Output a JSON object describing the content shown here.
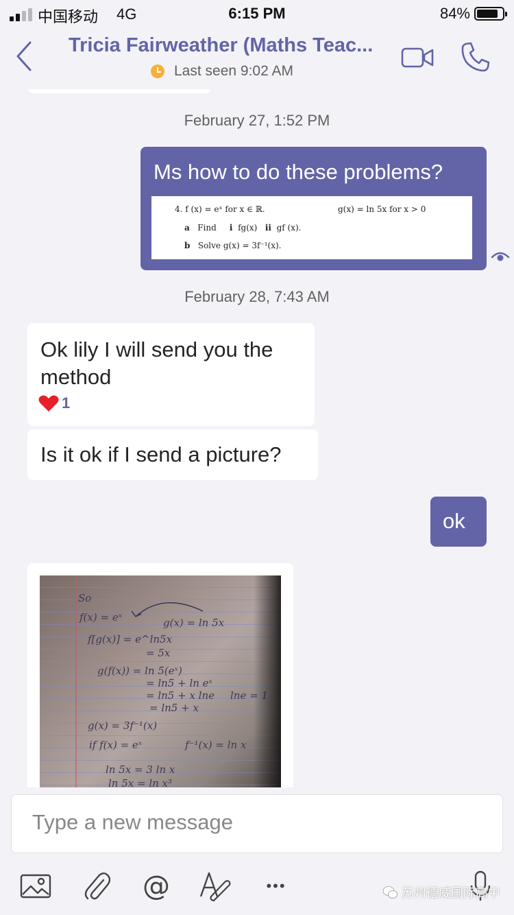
{
  "status_bar": {
    "carrier": "中国移动",
    "network": "4G",
    "time": "6:15 PM",
    "battery_percent": "84%",
    "battery_level": 0.84,
    "signal_bars": 4,
    "signal_active": 2
  },
  "header": {
    "title": "Tricia Fairweather (Maths Teac...",
    "presence_status": "away",
    "presence_color": "#f8b03a",
    "last_seen": "Last seen 9:02 AM",
    "back_icon": "chevron-left-icon",
    "video_icon": "video-camera-icon",
    "call_icon": "phone-icon"
  },
  "accent_color": "#6264a7",
  "conversation": {
    "timestamp_1": "February 27, 1:52 PM",
    "outgoing_1": {
      "text": "Ms how to do these problems?",
      "attachment": {
        "line1_left": "4. f (x) = eˣ for x ∈ ℝ.",
        "line1_right": "g(x) = ln 5x for x > 0",
        "line2_label": "a",
        "line2_text": "Find",
        "line2_i": "i",
        "line2_i_expr": "fg(x)",
        "line2_ii": "ii",
        "line2_ii_expr": "gf (x).",
        "line3_label": "b",
        "line3_text": "Solve g(x) = 3f⁻¹(x)."
      },
      "read_receipt_icon": "eye-icon"
    },
    "timestamp_2": "February 28, 7:43 AM",
    "incoming_1": {
      "text": "Ok lily I will send you the method",
      "reaction_icon": "heart-icon",
      "reaction_count": "1"
    },
    "incoming_2": {
      "text": "Is it ok if I send a picture?"
    },
    "outgoing_2": {
      "text": "ok"
    },
    "incoming_3": {
      "image_lines": [
        "So",
        "f(x) = eˣ",
        "g(x) = ln 5x",
        "f[g(x)] = e^ln5x",
        "= 5x",
        "g(f(x)) = ln 5(eˣ)",
        "= ln5 + ln eˣ",
        "= ln5 + x lne",
        "lne = 1",
        "= ln5 + x",
        "g(x) = 3f⁻¹(x)",
        "if f(x) = eˣ",
        "f⁻¹(x) = ln x",
        "ln 5x = 3 ln x",
        "ln 5x = ln x³"
      ]
    }
  },
  "composer": {
    "placeholder": "Type a new message"
  },
  "toolbar": {
    "icons": [
      "image-icon",
      "paperclip-icon",
      "at-mention-icon",
      "format-icon",
      "more-icon",
      "microphone-icon"
    ],
    "at_symbol": "@",
    "more_symbol": "•••"
  },
  "watermark": {
    "text": "苏州德威国际高中"
  }
}
